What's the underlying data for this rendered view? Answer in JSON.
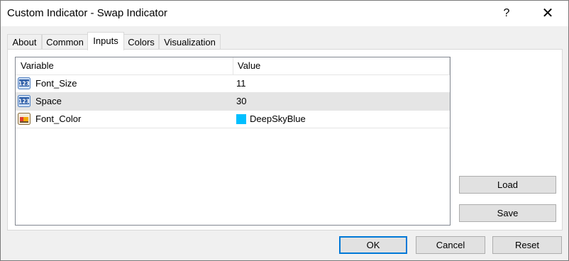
{
  "window": {
    "title": "Custom Indicator - Swap Indicator",
    "help_label": "?",
    "close_label": "✕"
  },
  "tabs": [
    {
      "label": "About"
    },
    {
      "label": "Common"
    },
    {
      "label": "Inputs"
    },
    {
      "label": "Colors"
    },
    {
      "label": "Visualization"
    }
  ],
  "active_tab": "Inputs",
  "grid": {
    "columns": [
      "Variable",
      "Value"
    ],
    "rows": [
      {
        "variable": "Font_Size",
        "value": "11",
        "icon": "integer-icon"
      },
      {
        "variable": "Space",
        "value": "30",
        "icon": "integer-icon"
      },
      {
        "variable": "Font_Color",
        "value": "DeepSkyBlue",
        "icon": "color-icon",
        "color": "#00bfff"
      }
    ]
  },
  "side_buttons": {
    "load": "Load",
    "save": "Save"
  },
  "footer_buttons": {
    "ok": "OK",
    "cancel": "Cancel",
    "reset": "Reset"
  }
}
